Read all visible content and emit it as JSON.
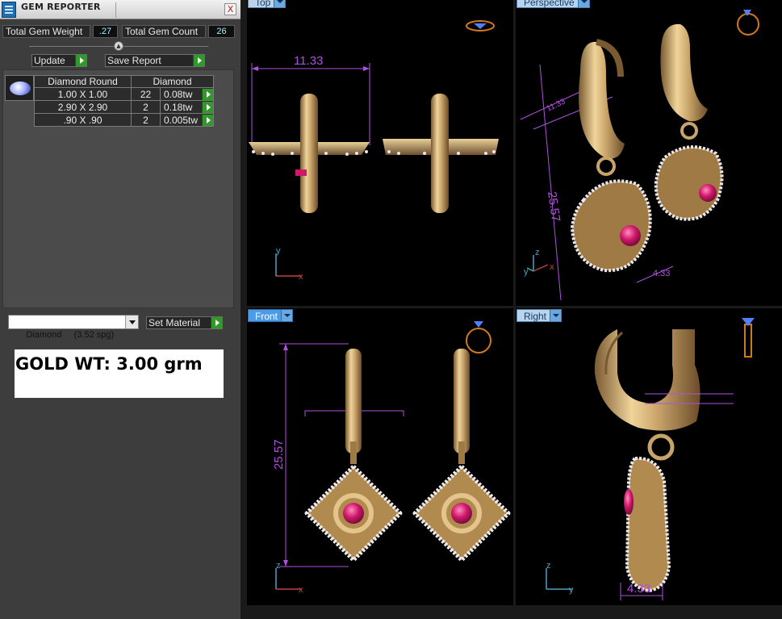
{
  "panel": {
    "title": "GEM REPORTER",
    "close_glyph": "X",
    "total_gem_weight_label": "Total Gem Weight",
    "total_gem_weight_value": ".27",
    "total_gem_count_label": "Total Gem Count",
    "total_gem_count_value": "26",
    "collapse_glyph": "▲",
    "update_label": "Update",
    "save_report_label": "Save Report",
    "table": {
      "headers": [
        "Diamond Round",
        "Diamond"
      ],
      "rows": [
        {
          "size": "1.00 X 1.00",
          "count": "22",
          "weight": "0.08tw"
        },
        {
          "size": "2.90 X 2.90",
          "count": "2",
          "weight": "0.18tw"
        },
        {
          "size": ".90 X .90",
          "count": "2",
          "weight": "0.005tw"
        }
      ]
    },
    "material_select": "Diamond     (3.52 spg)",
    "set_material_label": "Set Material",
    "gold_weight_note": "GOLD WT: 3.00 grm",
    "accent_green": "#2f9a2a",
    "value_color": "#9cf0ff"
  },
  "viewports": {
    "top": {
      "tab": "Top",
      "dimension": "11.33",
      "axis_x": "x",
      "axis_y": "y"
    },
    "perspective": {
      "tab": "Perspective",
      "dimension_height": "25.57",
      "dimension_width": "4.33",
      "dimension_top": "11.33",
      "axis_x": "x",
      "axis_y": "y",
      "axis_z": "z"
    },
    "front": {
      "tab": "Front",
      "dimension": "25.57",
      "axis_x": "x",
      "axis_z": "z"
    },
    "right": {
      "tab": "Right",
      "dimension": "4.33",
      "axis_y": "y",
      "axis_z": "z"
    },
    "dimension_color": "#b050e0",
    "metal_color": "#c9a46a",
    "ruby_color": "#d0186a"
  }
}
